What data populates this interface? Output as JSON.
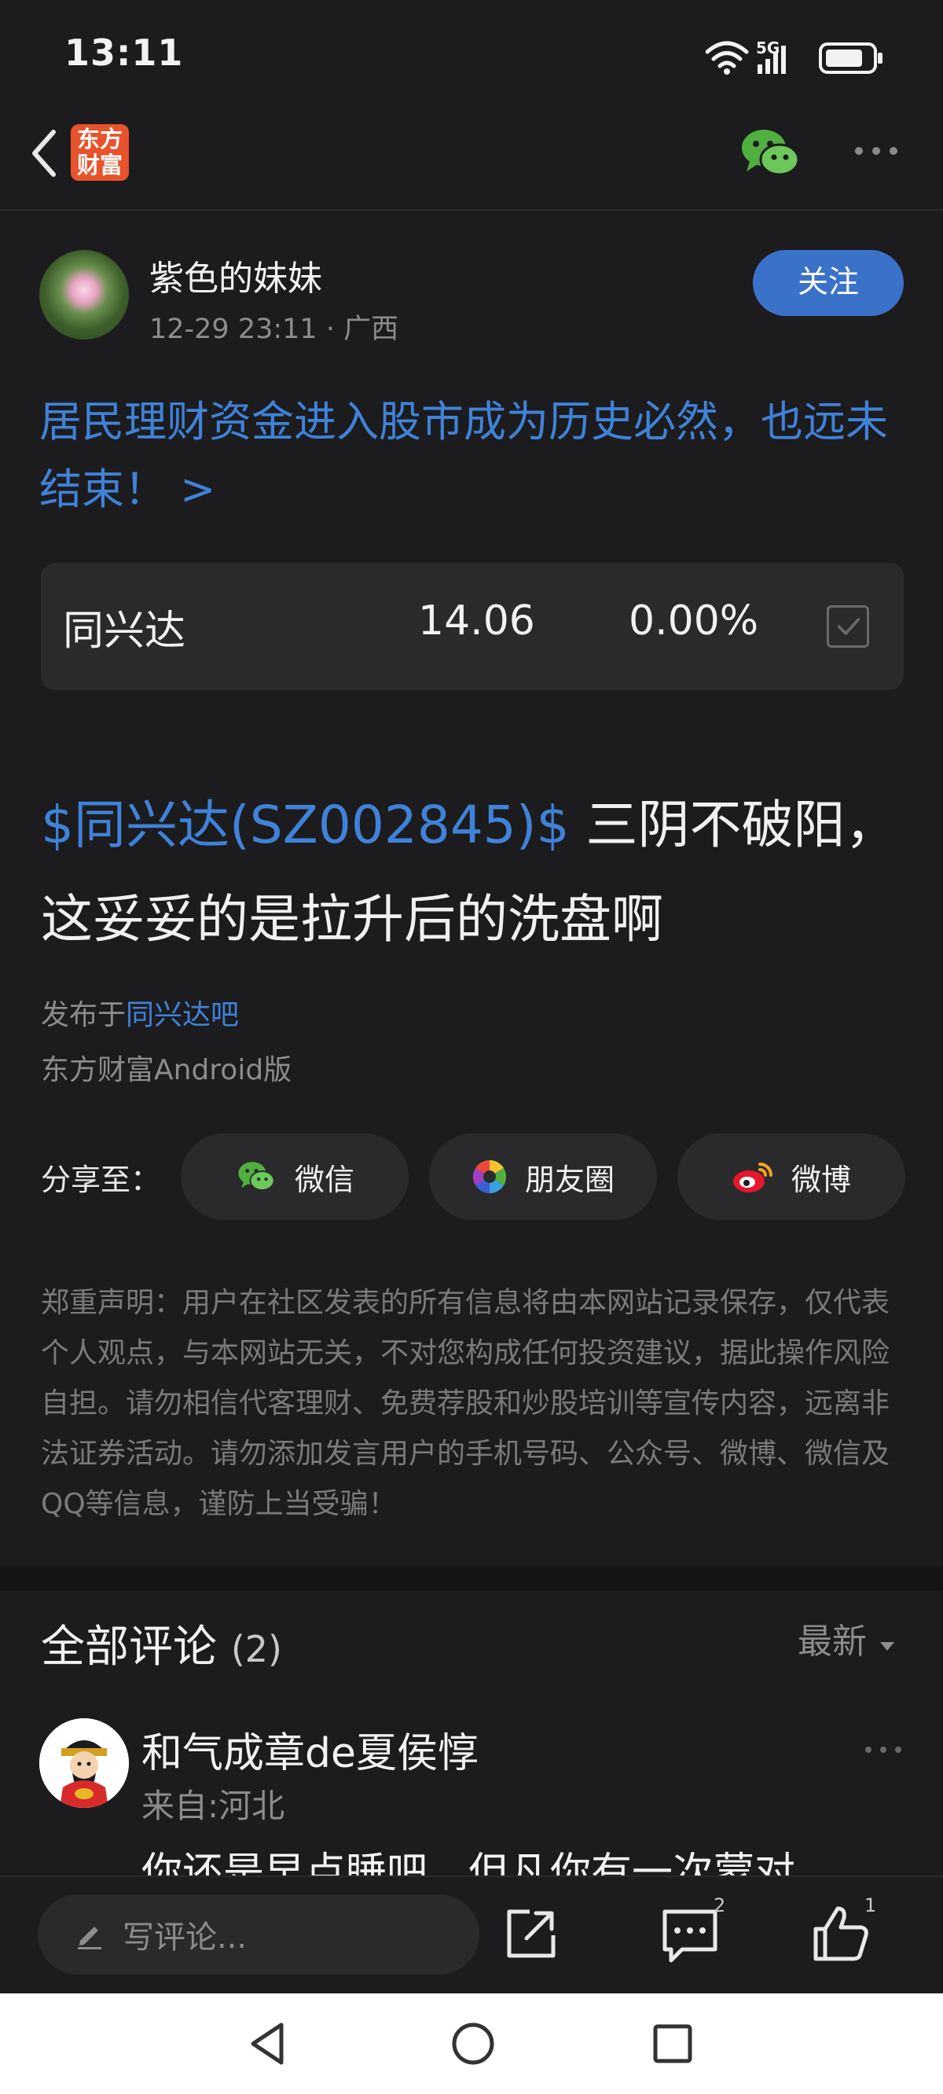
{
  "status_bar": {
    "time": "13:11",
    "network": "5G"
  },
  "topbar": {
    "logo_line1": "东方",
    "logo_line2": "财富"
  },
  "post": {
    "author": "紫色的妹妹",
    "meta": "12-29 23:11 · 广西",
    "follow_label": "关注",
    "headline": "居民理财资金进入股市成为历史必然，也远未结束！ >",
    "stock": {
      "name": "同兴达",
      "price": "14.06",
      "change": "0.00%"
    },
    "body_tag": "$同兴达(SZ002845)$",
    "body_text": " 三阴不破阳，这妥妥的是拉升后的洗盘啊",
    "published_prefix": "发布于",
    "published_bar": "同兴达吧",
    "client": "东方财富Android版"
  },
  "share": {
    "label": "分享至：",
    "wechat": "微信",
    "moments": "朋友圈",
    "weibo": "微博"
  },
  "disclaimer": "郑重声明：用户在社区发表的所有信息将由本网站记录保存，仅代表个人观点，与本网站无关，不对您构成任何投资建议，据此操作风险自担。请勿相信代客理财、免费荐股和炒股培训等宣传内容，远离非法证券活动。请勿添加发言用户的手机号码、公众号、微博、微信及QQ等信息，谨防上当受骗！",
  "comments": {
    "title": "全部评论",
    "count": "(2)",
    "sort": "最新",
    "first": {
      "user": "和气成章de夏侯惇",
      "location": "来自:河北",
      "text": "你还是早点睡吧，但凡你有一次蒙对"
    }
  },
  "action_bar": {
    "write_placeholder": "写评论...",
    "comment_count": "2",
    "like_count": "1"
  },
  "colors": {
    "accent": "#3f82d9",
    "background": "#1c1c1e",
    "card": "#2a2a2c",
    "logo": "#e8532b"
  }
}
